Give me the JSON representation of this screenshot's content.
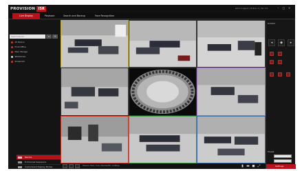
{
  "header": {
    "logo_text": "PROVISION",
    "logo_badge": "ISR",
    "user_info": "admin Logout | Online: 1 | Ver 1.0",
    "buttons": [
      "minimize-icon",
      "maximize-icon",
      "close-icon"
    ]
  },
  "tabs": [
    {
      "label": "Live Display",
      "active": true
    },
    {
      "label": "Playback",
      "active": false
    },
    {
      "label": "Search and Backup",
      "active": false
    },
    {
      "label": "Face Recognition",
      "active": false
    }
  ],
  "left_panel": {
    "search_placeholder": "Search device",
    "tree": [
      {
        "label": "All Device",
        "status": "#c0392b"
      },
      {
        "label": "Front Office",
        "status": "#c0392b"
      },
      {
        "label": "Main Storage",
        "status": "#c0392b"
      },
      {
        "label": "Warehouse",
        "status": "#cfcfcf"
      },
      {
        "label": "Showroom",
        "status": "#c0392b"
      }
    ],
    "menu": [
      {
        "label": "Device",
        "active": true
      },
      {
        "label": "E-Channel Sequence",
        "active": false
      },
      {
        "label": "Customized Display Modes",
        "active": false
      }
    ]
  },
  "bottom_bar": {
    "status_text": "Stream: Main / Sub  |  Bandwidth: 0.0Mbps"
  },
  "right_panel": {
    "title": "Control",
    "preset_label": "Preset",
    "settings_label": "Settings"
  },
  "colors": {
    "accent": "#b5121b",
    "bg": "#1a1a1a"
  }
}
